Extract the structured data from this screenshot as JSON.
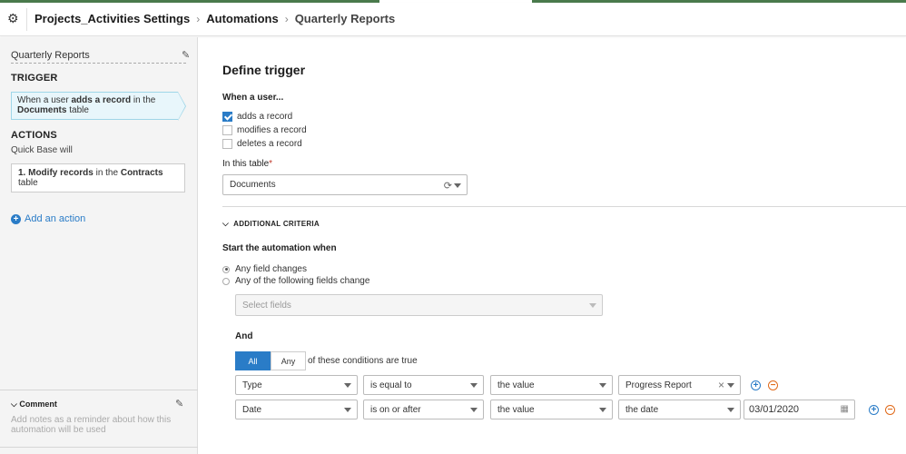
{
  "header": {
    "crumbs": [
      "Projects_Activities Settings",
      "Automations",
      "Quarterly Reports"
    ]
  },
  "sidebar": {
    "title": "Quarterly Reports",
    "trigger_heading": "TRIGGER",
    "trigger_card": {
      "pre": "When a user ",
      "bold1": "adds a record",
      "mid": " in the ",
      "bold2": "Documents",
      "post": " table"
    },
    "actions_heading": "ACTIONS",
    "actions_sub": "Quick Base will",
    "action_card": {
      "bold1": "1. Modify records",
      "mid": " in the ",
      "bold2": "Contracts",
      "post": " table"
    },
    "add_action": "Add an action",
    "comment": {
      "heading": "Comment",
      "placeholder": "Add notes as a reminder about how this automation will be used"
    }
  },
  "main": {
    "title": "Define trigger",
    "when_label": "When a user...",
    "events": [
      {
        "label": "adds a record",
        "checked": true
      },
      {
        "label": "modifies a record",
        "checked": false
      },
      {
        "label": "deletes a record",
        "checked": false
      }
    ],
    "table_label": "In this table",
    "table_required": "*",
    "table_value": "Documents",
    "additional_criteria": "ADDITIONAL CRITERIA",
    "start_label": "Start the automation when",
    "start_options": [
      {
        "label": "Any field changes",
        "selected": true
      },
      {
        "label": "Any of the following fields change",
        "selected": false
      }
    ],
    "select_fields_placeholder": "Select fields",
    "and_label": "And",
    "match": {
      "all": "All",
      "any": "Any",
      "suffix": "of these conditions are true",
      "active": "all"
    },
    "conditions": [
      {
        "field": "Type",
        "operator": "is equal to",
        "compare": "the value",
        "value": "Progress Report",
        "clearable": true
      },
      {
        "field": "Date",
        "operator": "is on or after",
        "compare": "the value",
        "value": "the date",
        "date": "03/01/2020"
      }
    ]
  }
}
